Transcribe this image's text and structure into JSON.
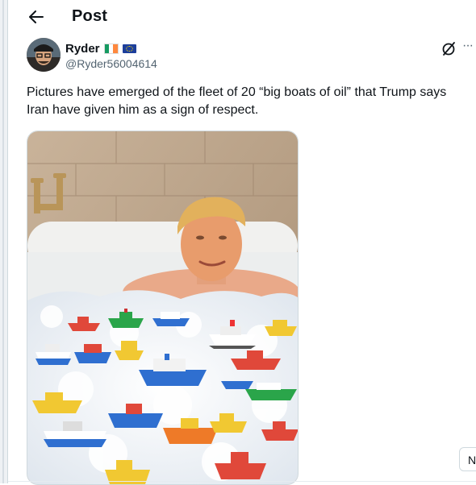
{
  "header": {
    "title": "Post",
    "back_icon": "arrow-left-icon"
  },
  "author": {
    "name": "Ryder",
    "handle": "@Ryder56004614",
    "badges": [
      "flag-ireland-icon",
      "flag-eu-icon"
    ]
  },
  "post": {
    "text": "Pictures have emerged of the fleet of 20 “big boats of oil” that Trump says Iran have given him as a sign of respect."
  },
  "actions": {
    "grok_icon": "grok-icon",
    "more_icon": "more-dots-icon"
  },
  "side_button": {
    "label": "N"
  },
  "colors": {
    "text": "#0f1419",
    "secondary": "#536471",
    "border": "#cfd9de",
    "accent": "#1d9bf0"
  }
}
